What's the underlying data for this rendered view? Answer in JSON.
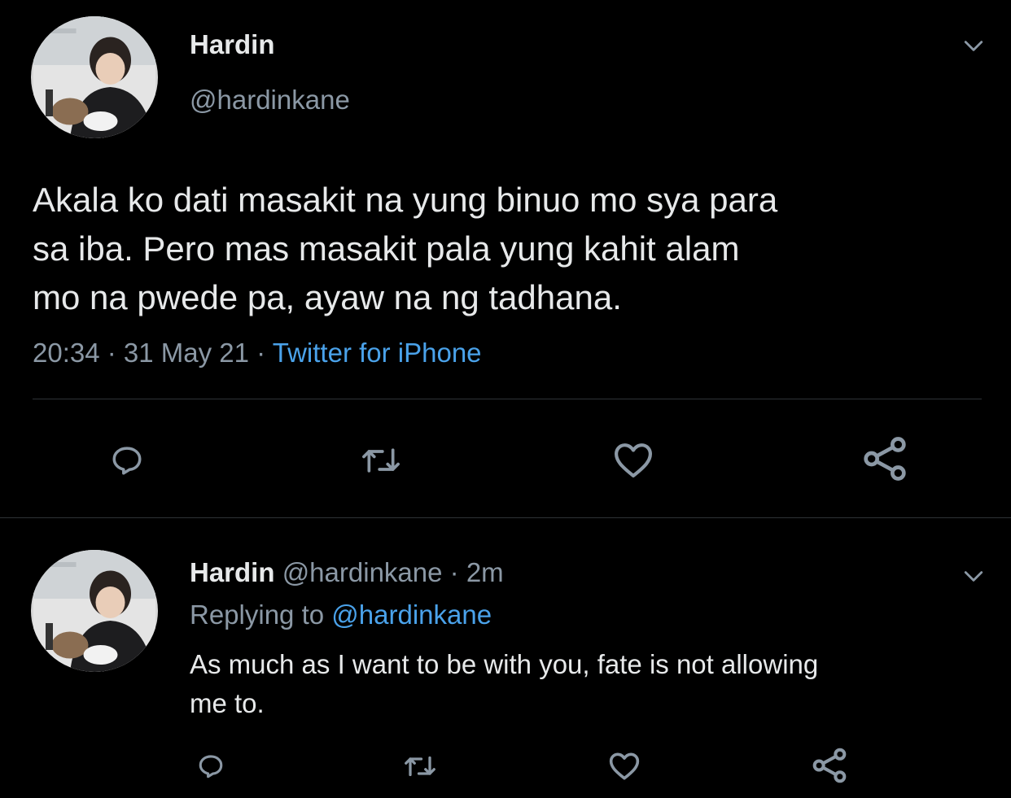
{
  "main_tweet": {
    "author_name": "Hardin",
    "author_handle": "@hardinkane",
    "avatar_icon": "profile-photo",
    "text_lines": [
      "Akala ko dati masakit na yung binuo mo sya para",
      "sa iba. Pero mas masakit pala yung kahit alam",
      "mo na pwede pa, ayaw na ng tadhana."
    ],
    "time": "20:34",
    "date": "31 May 21",
    "separator": " · ",
    "source": "Twitter for iPhone",
    "actions": [
      "reply-icon",
      "retweet-icon",
      "like-icon",
      "share-icon"
    ]
  },
  "reply_tweet": {
    "author_name": "Hardin",
    "author_handle": "@hardinkane",
    "age": "2m",
    "separator": " · ",
    "replying_prefix": "Replying to ",
    "replying_handle": "@hardinkane",
    "text_lines": [
      "As much as I want to be with you, fate is not allowing",
      "me to."
    ],
    "actions": [
      "reply-icon",
      "retweet-icon",
      "like-icon",
      "share-icon"
    ]
  },
  "colors": {
    "background": "#000000",
    "primary_text": "#e7e9ea",
    "secondary_text": "#8b98a5",
    "link": "#4aa2ea",
    "divider": "#2f3336"
  }
}
